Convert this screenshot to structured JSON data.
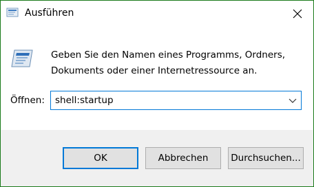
{
  "window": {
    "title": "Ausführen",
    "app_icon": "run-icon",
    "close_icon": "close-icon"
  },
  "content": {
    "description_line1": "Geben Sie den Namen eines Programms, Ordners,",
    "description_line2": "Dokuments oder einer Internetressource an.",
    "open_label": "Öffnen:",
    "open_value": "shell:startup",
    "dropdown_icon": "chevron-down-icon"
  },
  "buttons": {
    "ok_label": "OK",
    "cancel_label": "Abbrechen",
    "browse_label": "Durchsuchen..."
  },
  "colors": {
    "accent": "#0078d7",
    "button_bg": "#e1e1e1",
    "footer_bg": "#f0f0f0"
  }
}
